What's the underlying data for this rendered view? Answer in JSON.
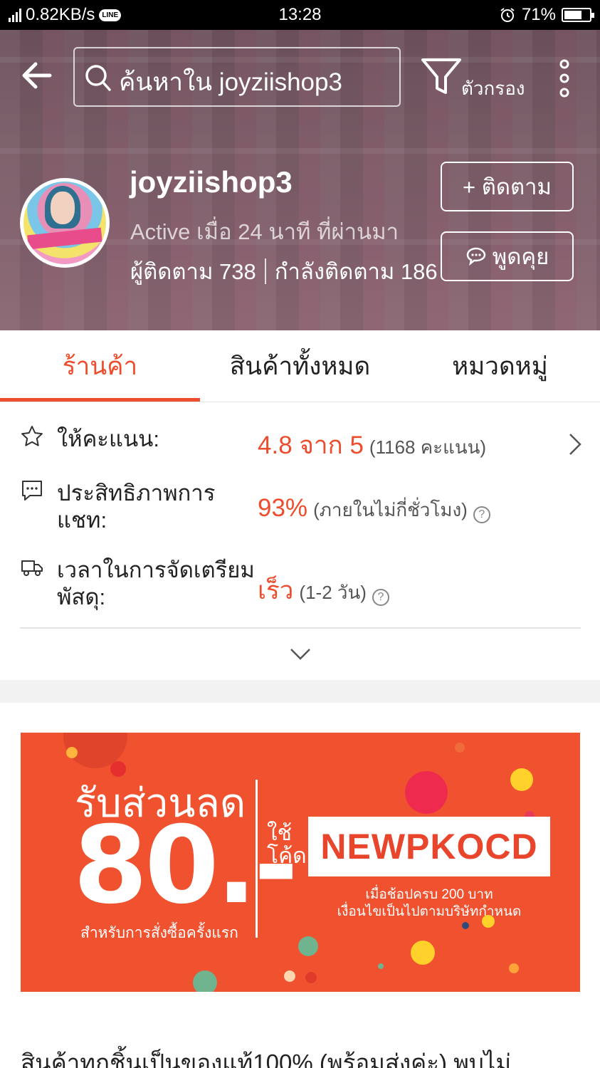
{
  "status_bar": {
    "network": "4G",
    "speed": "0.82KB/s",
    "app_badge": "LINE",
    "time": "13:28",
    "battery_percent": "71%",
    "battery_level": 0.71
  },
  "header": {
    "search_placeholder": "ค้นหาใน joyziishop3",
    "filter_label": "ตัวกรอง",
    "shop_name": "joyziishop3",
    "active_status": "Active เมื่อ 24 นาที ที่ผ่านมา",
    "followers_text": "ผู้ติดตาม 738",
    "following_text": "กำลังติดตาม 186",
    "follow_button": "+ ติดตาม",
    "chat_button": "พูดคุย"
  },
  "tabs": [
    {
      "label": "ร้านค้า",
      "active": true
    },
    {
      "label": "สินค้าทั้งหมด",
      "active": false
    },
    {
      "label": "หมวดหมู่",
      "active": false
    }
  ],
  "stats": {
    "rating": {
      "label": "ให้คะแนน:",
      "value": "4.8 จาก 5",
      "detail": "(1168 คะแนน)"
    },
    "chat_performance": {
      "label": "ประสิทธิภาพการแชท:",
      "value": "93%",
      "detail": "(ภายในไม่กี่ชั่วโมง)"
    },
    "preparation_time": {
      "label": "เวลาในการจัดเตรียมพัสดุ:",
      "value": "เร็ว",
      "detail": "(1-2 วัน)"
    }
  },
  "promo": {
    "title": "รับส่วนลด",
    "amount": "80.-",
    "subtitle": "สำหรับการสั่งซื้อครั้งแรก",
    "use_code": "ใช้ โค้ด",
    "code": "NEWPKOCD",
    "condition_1": "เมื่อช้อปครบ 200 บาท",
    "condition_2": "เงื่อนไขเป็นไปตามบริษัทกำหนด"
  },
  "description": "สินค้าทุกชิ้นเป็นของแท้100% (พร้อมส่งค่ะ) พบไม่",
  "colors": {
    "accent": "#ee4d2d",
    "promo_bg": "#f0522f"
  }
}
